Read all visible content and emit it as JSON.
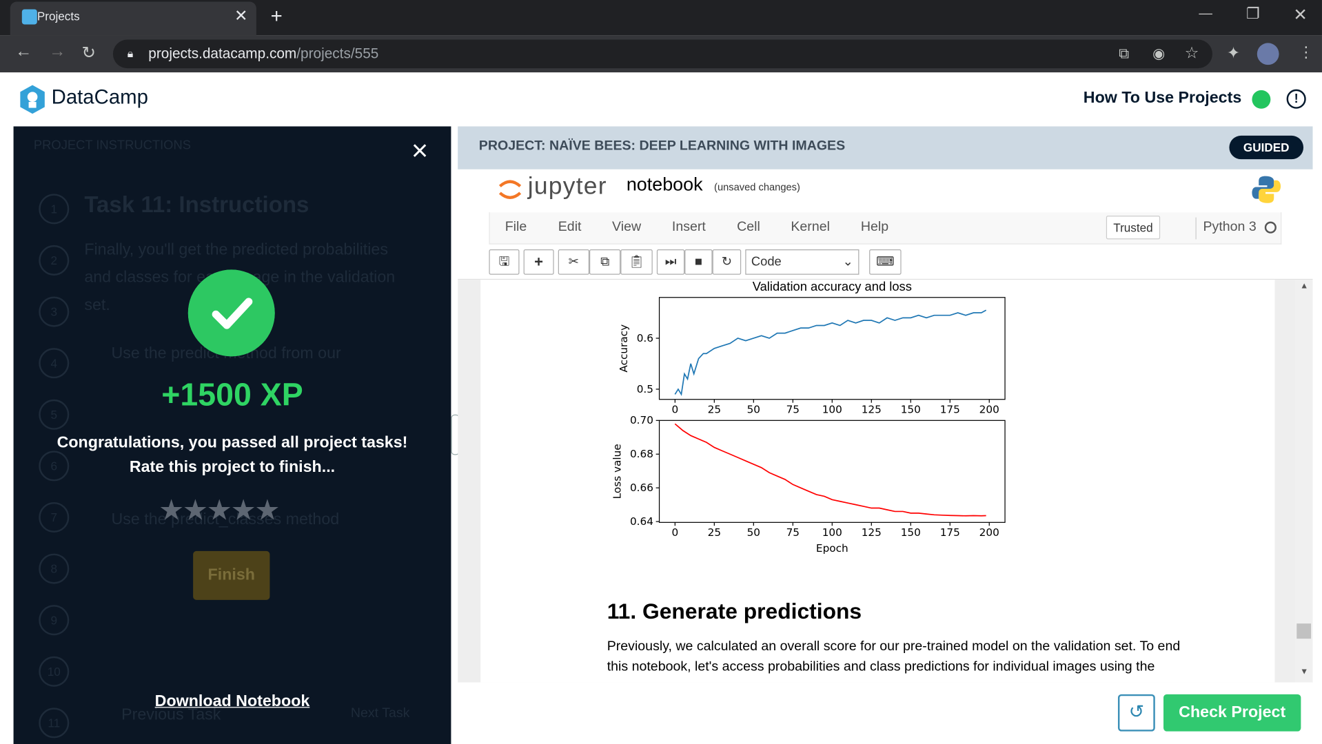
{
  "browser": {
    "tab_title": "Projects",
    "url_host": "projects.datacamp.com",
    "url_path": "/projects/555"
  },
  "header": {
    "brand": "DataCamp",
    "how_to": "How To Use Projects",
    "alert": "!"
  },
  "modal": {
    "xp": "+1500 XP",
    "congrats": "Congratulations, you passed all project tasks!",
    "rate": "Rate this project to finish...",
    "stars": "★★★★★",
    "rating_value": 0,
    "finish": "Finish",
    "download": "Download Notebook",
    "close": "×"
  },
  "background_panel": {
    "heading": "PROJECT INSTRUCTIONS",
    "task_title": "Task 11: Instructions",
    "line1": "Finally, you'll get the predicted probabilities",
    "line2": "and classes for each image in the validation",
    "line3": "set.",
    "bullet1": "Use the predict method from our",
    "bullet3": "Use the predict_classes method",
    "prev": "Previous Task",
    "next": "Next Task",
    "steps": [
      "1",
      "2",
      "3",
      "4",
      "5",
      "6",
      "7",
      "8",
      "9",
      "10",
      "11"
    ]
  },
  "project": {
    "title": "PROJECT: NAÏVE BEES: DEEP LEARNING WITH IMAGES",
    "badge": "GUIDED"
  },
  "jupyter": {
    "logo": "jupyter",
    "notebook": "notebook",
    "unsaved": "(unsaved changes)",
    "menu": [
      "File",
      "Edit",
      "View",
      "Insert",
      "Cell",
      "Kernel",
      "Help"
    ],
    "trusted": "Trusted",
    "kernel": "Python 3",
    "cell_type": "Code"
  },
  "notebook": {
    "heading": "11. Generate predictions",
    "para_line1": "Previously, we calculated an overall score for our pre-trained model on the validation set. To end",
    "para_line2": "this notebook, let's access probabilities and class predictions for individual images using the"
  },
  "buttons": {
    "check_project": "Check Project"
  },
  "chart_data": [
    {
      "type": "line",
      "title": "Validation accuracy and loss",
      "xlabel": "",
      "ylabel": "Accuracy",
      "xlim": [
        -10,
        210
      ],
      "ylim": [
        0.48,
        0.68
      ],
      "xticks": [
        "0",
        "25",
        "50",
        "75",
        "100",
        "125",
        "150",
        "175",
        "200"
      ],
      "yticks": [
        "0.5",
        "0.6"
      ],
      "series": [
        {
          "color": "#1f77b4",
          "x": [
            0,
            2,
            4,
            6,
            8,
            10,
            12,
            15,
            18,
            20,
            25,
            30,
            35,
            40,
            45,
            50,
            55,
            60,
            65,
            70,
            75,
            80,
            85,
            90,
            95,
            100,
            105,
            110,
            115,
            120,
            125,
            130,
            135,
            140,
            145,
            150,
            155,
            160,
            165,
            170,
            175,
            180,
            185,
            190,
            195,
            198
          ],
          "y": [
            0.49,
            0.5,
            0.49,
            0.53,
            0.52,
            0.55,
            0.53,
            0.56,
            0.57,
            0.57,
            0.58,
            0.585,
            0.59,
            0.6,
            0.595,
            0.6,
            0.605,
            0.6,
            0.61,
            0.61,
            0.615,
            0.62,
            0.62,
            0.625,
            0.625,
            0.63,
            0.625,
            0.635,
            0.63,
            0.635,
            0.635,
            0.63,
            0.64,
            0.635,
            0.64,
            0.64,
            0.645,
            0.64,
            0.645,
            0.645,
            0.645,
            0.65,
            0.645,
            0.65,
            0.65,
            0.655
          ]
        }
      ]
    },
    {
      "type": "line",
      "xlabel": "Epoch",
      "ylabel": "Loss value",
      "xlim": [
        -10,
        210
      ],
      "ylim": [
        0.6395,
        0.7
      ],
      "xticks": [
        "0",
        "25",
        "50",
        "75",
        "100",
        "125",
        "150",
        "175",
        "200"
      ],
      "yticks": [
        "0.64",
        "0.66",
        "0.68",
        "0.70"
      ],
      "series": [
        {
          "color": "#ff0000",
          "x": [
            0,
            5,
            10,
            15,
            20,
            25,
            30,
            35,
            40,
            45,
            50,
            55,
            60,
            65,
            70,
            75,
            80,
            85,
            90,
            95,
            100,
            105,
            110,
            115,
            120,
            125,
            130,
            135,
            140,
            145,
            150,
            155,
            160,
            165,
            170,
            175,
            180,
            185,
            190,
            195,
            198
          ],
          "y": [
            0.698,
            0.694,
            0.691,
            0.689,
            0.687,
            0.684,
            0.682,
            0.68,
            0.678,
            0.676,
            0.674,
            0.672,
            0.669,
            0.667,
            0.665,
            0.662,
            0.66,
            0.658,
            0.656,
            0.655,
            0.653,
            0.652,
            0.651,
            0.65,
            0.649,
            0.648,
            0.648,
            0.647,
            0.646,
            0.646,
            0.645,
            0.645,
            0.6445,
            0.644,
            0.6438,
            0.6436,
            0.6435,
            0.6434,
            0.6435,
            0.6434,
            0.6435
          ]
        }
      ]
    }
  ]
}
